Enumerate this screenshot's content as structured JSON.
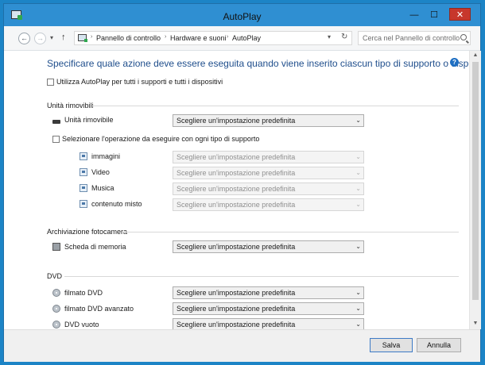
{
  "window": {
    "title": "AutoPlay",
    "controls": {
      "minimize": "—",
      "maximize": "☐",
      "close": "✕"
    }
  },
  "nav": {
    "back_glyph": "←",
    "forward_glyph": "→",
    "recent_glyph": "▾",
    "up_glyph": "↑",
    "breadcrumbs": [
      "Pannello di controllo",
      "Hardware e suoni",
      "AutoPlay"
    ],
    "separator": "›",
    "dropdown_glyph": "▾",
    "refresh_glyph": "↻",
    "search_placeholder": "Cerca nel Pannello di controllo"
  },
  "content": {
    "heading": "Specificare quale azione deve essere eseguita quando viene inserito ciascun tipo di supporto o dispositivo",
    "help": "?",
    "use_autoplay_label": "Utilizza AutoPlay per tutti i supporti e tutti i dispositivi",
    "default_choice": "Scegliere un'impostazione predefinita",
    "dropdown_arrow": "⌄",
    "removable": {
      "section": "Unità rimovibili",
      "drive_label": "Unità rimovibile",
      "select_each_label": "Selezionare l'operazione da eseguire con ogni tipo di supporto",
      "sub_items": [
        "immagini",
        "Video",
        "Musica",
        "contenuto misto"
      ]
    },
    "camera": {
      "section": "Archiviazione fotocamera",
      "card_label": "Scheda di memoria"
    },
    "dvd": {
      "section": "DVD",
      "items": [
        "filmato DVD",
        "filmato DVD avanzato",
        "DVD vuoto"
      ]
    }
  },
  "scrollbar": {
    "up": "▲",
    "down": "▼"
  },
  "footer": {
    "save": "Salva",
    "cancel": "Annulla"
  }
}
